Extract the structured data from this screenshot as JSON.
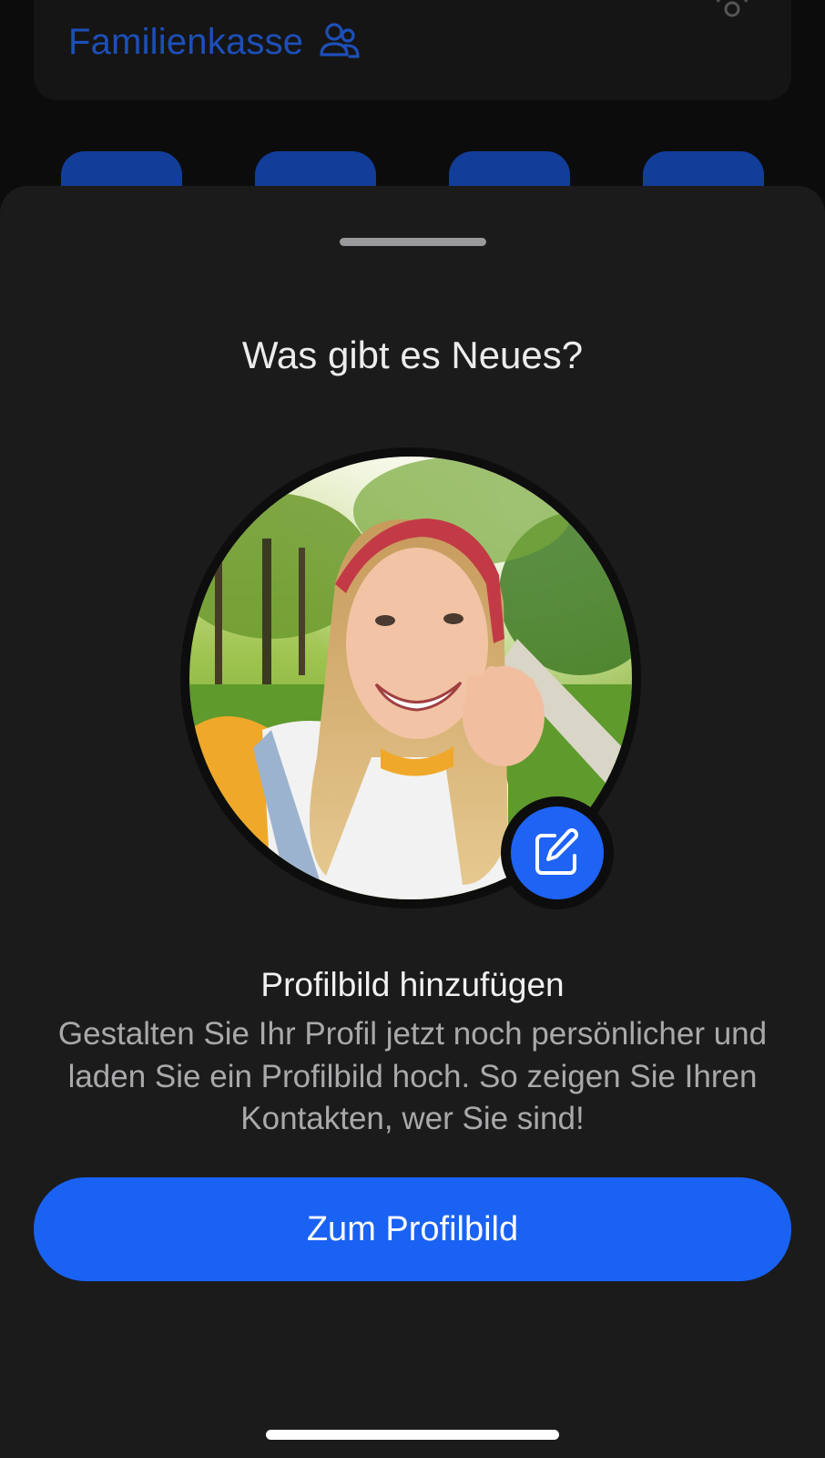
{
  "background_app": {
    "title": "Familienkasse",
    "title_icon": "people-icon",
    "corner_icon": "account-icon",
    "shortcut_count_visible": 4,
    "accent_color": "#1d4fb8"
  },
  "sheet": {
    "title": "Was gibt es Neues?",
    "avatar": {
      "description_icon": "profile-photo",
      "edit_icon": "edit-icon"
    },
    "heading": "Profilbild hinzufügen",
    "body": "Gestalten Sie Ihr Profil jetzt noch persönlicher und laden Sie ein Profilbild hoch. So zeigen Sie Ihren Kontakten, wer Sie sind!",
    "cta_label": "Zum Profilbild",
    "cta_color": "#1a62f3"
  }
}
